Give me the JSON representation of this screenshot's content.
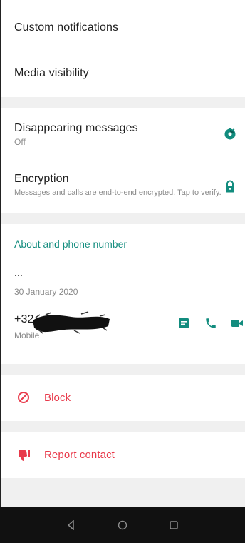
{
  "settings_top": {
    "custom_notifications": "Custom notifications",
    "media_visibility": "Media visibility"
  },
  "disappearing": {
    "title": "Disappearing messages",
    "value": "Off"
  },
  "encryption": {
    "title": "Encryption",
    "subtitle": "Messages and calls are end-to-end encrypted. Tap to verify."
  },
  "about": {
    "section_title": "About and phone number",
    "about_text": "...",
    "about_date": "30 January 2020",
    "phone_prefix": "+32",
    "phone_type": "Mobile"
  },
  "actions": {
    "block_label": "Block",
    "report_label": "Report contact"
  },
  "colors": {
    "accent": "#128c7e",
    "danger": "#e8394a",
    "nav_bar": "#111111"
  },
  "icons": {
    "disappearing": "timer-icon",
    "encryption": "lock-icon",
    "message": "message-icon",
    "call": "phone-icon",
    "video": "video-icon",
    "block": "block-icon",
    "report": "thumbs-down-icon",
    "nav_back": "nav-back-icon",
    "nav_home": "nav-home-icon",
    "nav_recents": "nav-recents-icon"
  }
}
